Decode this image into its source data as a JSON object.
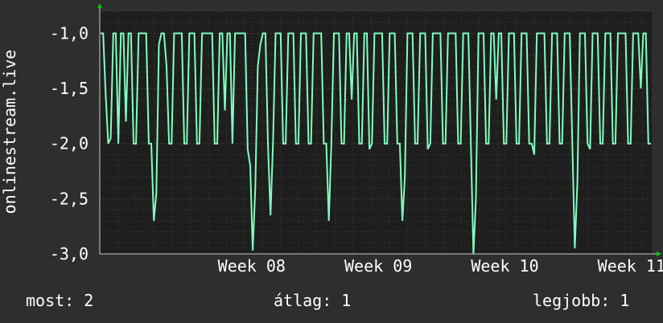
{
  "chart_data": {
    "type": "line",
    "ylabel": "onlinestream.live",
    "ylim": [
      -3.0,
      -0.8
    ],
    "y_ticks": [
      "-1,0",
      "-1,5",
      "-2,0",
      "-2,5",
      "-3,0"
    ],
    "y_tick_values": [
      -1.0,
      -1.5,
      -2.0,
      -2.5,
      -3.0
    ],
    "x_ticks": [
      "Week 08",
      "Week 09",
      "Week 10",
      "Week 11"
    ],
    "x_tick_positions": [
      1.2,
      2.2,
      3.2,
      4.2
    ],
    "xlim": [
      0.0,
      4.36
    ],
    "grid": true,
    "colors": {
      "background": "#2e2e2e",
      "plot": "#1e1e1e",
      "line": "#7fffbf",
      "grid": "#4a4a4a",
      "axis_arrow": "#00cc00"
    },
    "series": [
      {
        "y": [
          -1.0,
          -1.0,
          -1.55,
          -2.0,
          -1.95,
          -1.0,
          -1.0,
          -2.0,
          -1.0,
          -1.0,
          -1.8,
          -1.0,
          -1.0,
          -2.0,
          -2.0,
          -1.0,
          -1.0,
          -1.0,
          -1.0,
          -2.0,
          -2.0,
          -2.7,
          -2.45,
          -1.1,
          -1.0,
          -1.0,
          -1.3,
          -2.0,
          -2.0,
          -1.0,
          -1.0,
          -1.0,
          -1.0,
          -2.0,
          -2.0,
          -1.0,
          -1.0,
          -1.0,
          -2.0,
          -2.0,
          -1.0,
          -1.0,
          -1.0,
          -1.0,
          -1.0,
          -2.0,
          -2.0,
          -1.0,
          -1.0,
          -1.7,
          -1.0,
          -1.0,
          -2.0,
          -1.0,
          -1.0,
          -1.0,
          -1.0,
          -1.0,
          -2.05,
          -2.2,
          -2.97,
          -2.4,
          -1.3,
          -1.1,
          -1.0,
          -1.0,
          -2.0,
          -2.65,
          -2.0,
          -1.0,
          -1.0,
          -1.0,
          -2.0,
          -2.0,
          -1.0,
          -1.0,
          -1.0,
          -2.0,
          -2.0,
          -1.0,
          -1.0,
          -1.0,
          -2.0,
          -2.0,
          -1.0,
          -1.0,
          -1.0,
          -1.0,
          -2.0,
          -2.0,
          -2.7,
          -2.0,
          -1.0,
          -1.0,
          -1.0,
          -2.0,
          -2.0,
          -1.0,
          -1.0,
          -1.6,
          -1.0,
          -1.0,
          -2.0,
          -2.0,
          -1.0,
          -1.0,
          -2.05,
          -2.0,
          -1.0,
          -1.0,
          -1.0,
          -1.0,
          -2.0,
          -2.0,
          -1.0,
          -1.0,
          -1.0,
          -2.0,
          -2.0,
          -2.7,
          -2.3,
          -1.0,
          -1.0,
          -1.0,
          -2.0,
          -2.0,
          -1.0,
          -1.0,
          -1.0,
          -2.05,
          -2.0,
          -1.0,
          -1.0,
          -1.0,
          -1.0,
          -2.0,
          -2.0,
          -1.0,
          -1.0,
          -1.0,
          -1.0,
          -2.0,
          -2.0,
          -1.0,
          -1.0,
          -1.0,
          -2.0,
          -3.0,
          -2.5,
          -1.0,
          -1.0,
          -1.0,
          -2.0,
          -2.0,
          -1.0,
          -1.0,
          -1.6,
          -1.0,
          -1.0,
          -2.0,
          -2.0,
          -1.0,
          -1.0,
          -1.0,
          -2.0,
          -2.0,
          -1.0,
          -1.0,
          -1.0,
          -2.0,
          -2.0,
          -2.1,
          -1.0,
          -1.0,
          -1.0,
          -1.0,
          -2.0,
          -2.0,
          -1.0,
          -1.0,
          -1.0,
          -2.0,
          -2.0,
          -1.0,
          -1.0,
          -1.0,
          -2.0,
          -2.95,
          -2.35,
          -1.0,
          -1.0,
          -1.0,
          -2.0,
          -2.05,
          -1.0,
          -1.0,
          -1.0,
          -2.0,
          -2.0,
          -1.0,
          -1.0,
          -1.0,
          -2.0,
          -2.0,
          -1.0,
          -1.0,
          -1.0,
          -1.0,
          -2.0,
          -2.0,
          -1.0,
          -1.0,
          -1.0,
          -1.5,
          -1.0,
          -1.0,
          -2.0,
          -2.0
        ]
      }
    ],
    "legend": [
      {
        "label": "most:",
        "value": "2"
      },
      {
        "label": "átlag:",
        "value": "1"
      },
      {
        "label": "legjobb:",
        "value": "1"
      }
    ]
  }
}
